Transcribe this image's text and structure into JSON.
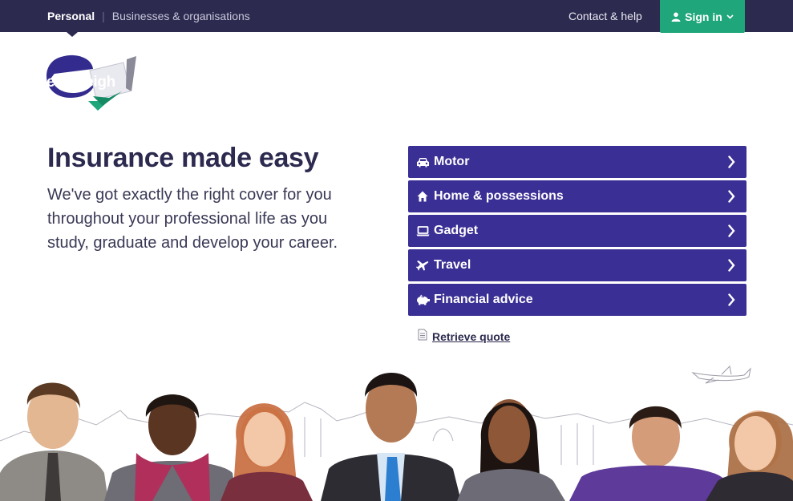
{
  "nav": {
    "personal": "Personal",
    "separator": "|",
    "business": "Businesses & organisations",
    "contact": "Contact & help",
    "signin": "Sign in"
  },
  "brand": {
    "logo_text": "endsleigh"
  },
  "hero": {
    "headline": "Insurance made easy",
    "lede": "We've got exactly the right cover for you throughout your professional life as you study, graduate and develop your career."
  },
  "products": [
    {
      "label": "Motor",
      "icon": "car-icon"
    },
    {
      "label": "Home & possessions",
      "icon": "house-icon"
    },
    {
      "label": "Gadget",
      "icon": "laptop-icon"
    },
    {
      "label": "Travel",
      "icon": "plane-icon"
    },
    {
      "label": "Financial advice",
      "icon": "piggy-bank-icon"
    }
  ],
  "retrieve": {
    "label": "Retrieve quote",
    "icon": "document-icon"
  },
  "colors": {
    "topbar": "#2c2a4f",
    "signin_green": "#1fa67a",
    "product_purple": "#3a2f94",
    "logo_purple": "#332c8e",
    "logo_green": "#1fa67a"
  }
}
